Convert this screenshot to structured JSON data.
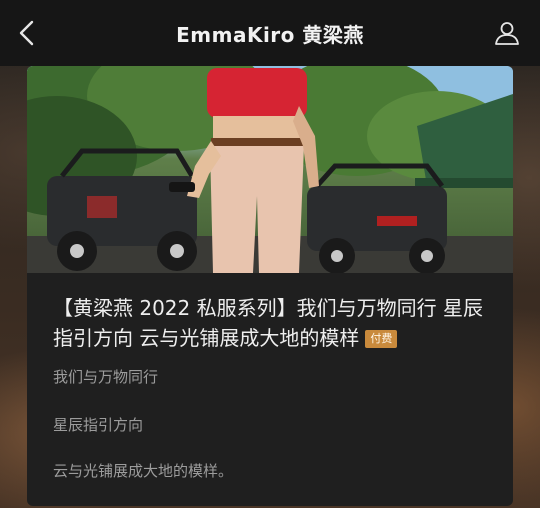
{
  "header": {
    "title": "EmmaKiro 黄梁燕",
    "back_icon": "chevron-left-icon",
    "profile_icon": "user-icon"
  },
  "post": {
    "title": "【黄梁燕 2022 私服系列】我们与万物同行 星辰指引方向 云与光铺展成大地的模样",
    "badge": "付费",
    "paragraphs": [
      "我们与万物同行",
      "星辰指引方向",
      "云与光铺展成大地的模样。"
    ]
  },
  "colors": {
    "header_bg": "#161616",
    "card_bg": "#1f1f1f",
    "badge_bg": "#c98a3c",
    "title_text": "#eeeeee",
    "body_text": "#9c9c9c"
  }
}
